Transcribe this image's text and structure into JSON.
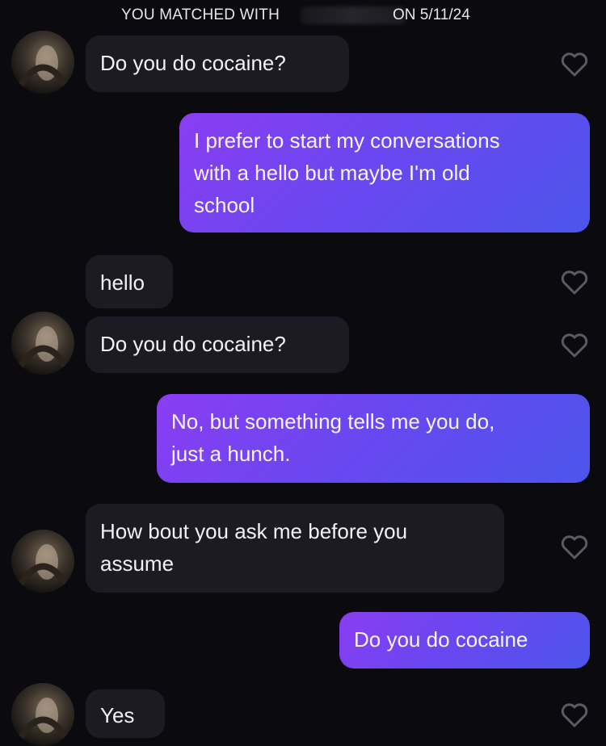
{
  "header": {
    "matched_prefix": "YOU MATCHED WITH",
    "matched_date": "ON 5/11/24"
  },
  "messages": [
    {
      "from": "them",
      "text": "Do you do cocaine?"
    },
    {
      "from": "me",
      "text": "I prefer to start my conversations\nwith a hello but maybe I'm old\nschool"
    },
    {
      "from": "them",
      "text": "hello"
    },
    {
      "from": "them",
      "text": "Do you do cocaine?"
    },
    {
      "from": "me",
      "text": "No, but something tells me you do,\njust a hunch."
    },
    {
      "from": "them",
      "text": "How bout you ask me before you\nassume"
    },
    {
      "from": "me",
      "text": "Do you do cocaine"
    },
    {
      "from": "them",
      "text": "Yes"
    }
  ],
  "icons": {
    "avatar": "profile-photo",
    "like": "heart-outline-icon"
  },
  "colors": {
    "background": "#0b0b0f",
    "received_bubble": "#1c1b24",
    "sent_gradient_start": "#8b3df3",
    "sent_gradient_end": "#4c55ec",
    "heart_outline": "#5a5a64"
  }
}
